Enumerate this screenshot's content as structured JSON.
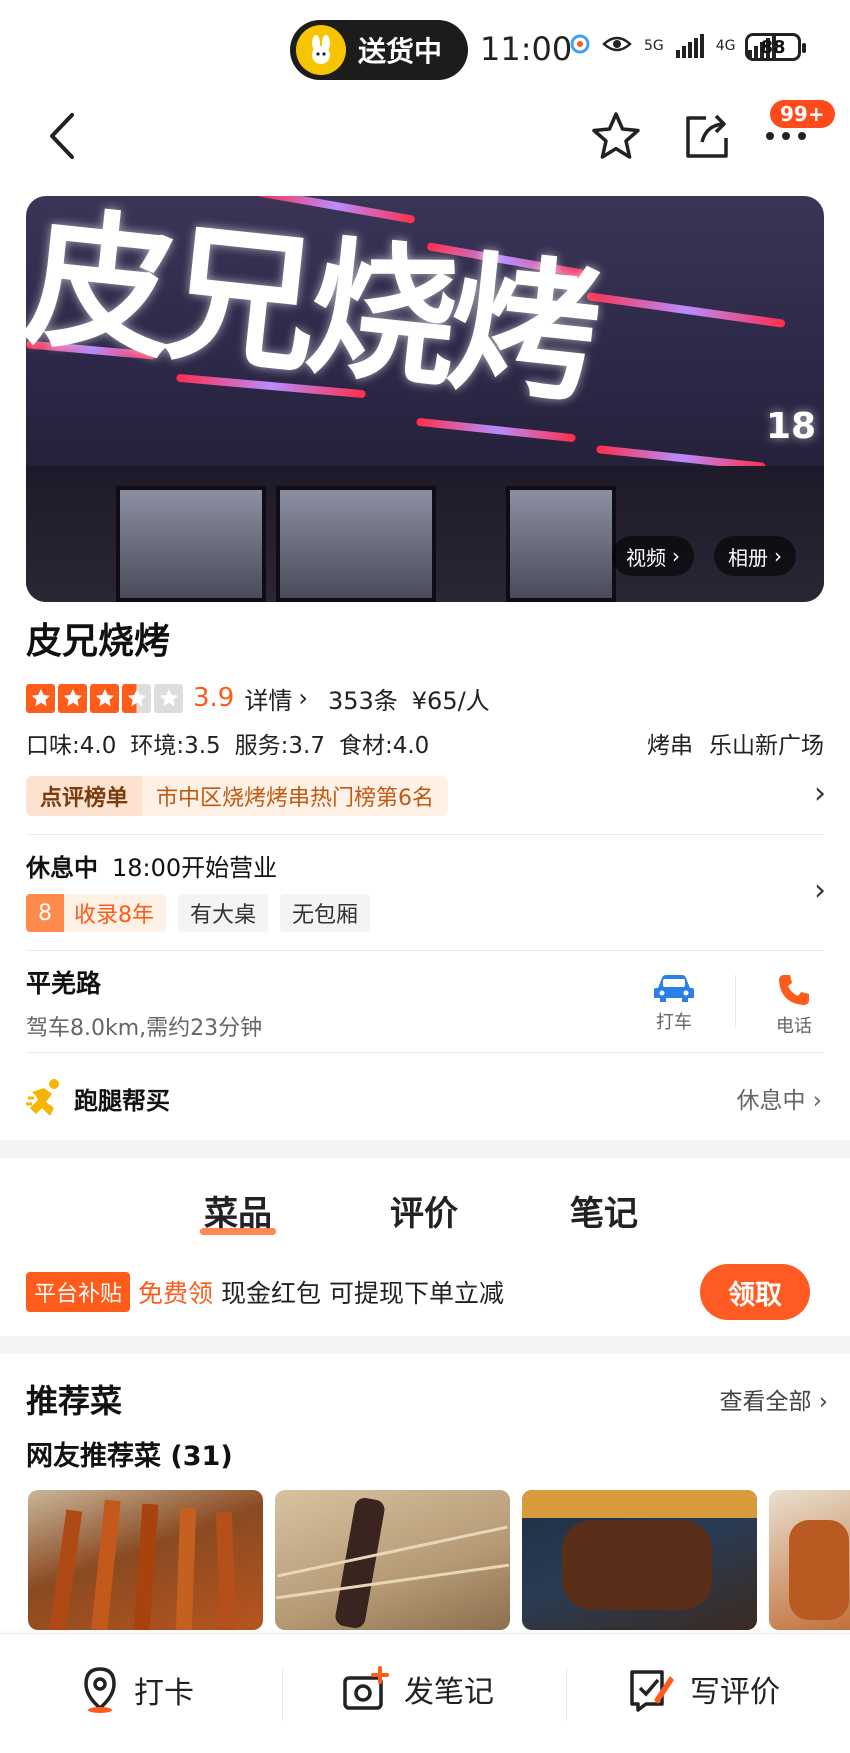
{
  "status_bar": {
    "delivery_label": "送货中",
    "time": "11:00",
    "net1": "5G",
    "net2": "4G",
    "battery": "88"
  },
  "nav": {
    "more_badge": "99+"
  },
  "hero": {
    "sign_text": "皮兄烧烤",
    "sign_phone": "18",
    "video_label": "视频",
    "album_label": "相册"
  },
  "shop": {
    "name": "皮兄烧烤",
    "rating": 3.5,
    "score": "3.9",
    "details_label": "详情",
    "review_count": "353条",
    "avg_price": "¥65/人",
    "sub_scores": [
      "口味:4.0",
      "环境:3.5",
      "服务:3.7",
      "食材:4.0"
    ],
    "category": "烤串",
    "area": "乐山新广场",
    "rank_badge": "点评榜单",
    "rank_text": "市中区烧烤烤串热门榜第6名"
  },
  "hours": {
    "status": "休息中",
    "open_time": "18:00开始营业",
    "years_num": "8",
    "years_label": "收录8年",
    "feature1": "有大桌",
    "feature2": "无包厢"
  },
  "address": {
    "road": "平羌路",
    "drive": "驾车8.0km,需约23分钟",
    "taxi_label": "打车",
    "phone_label": "电话"
  },
  "errand": {
    "label": "跑腿帮买",
    "status": "休息中"
  },
  "tabs": [
    "菜品",
    "评价",
    "笔记"
  ],
  "promo": {
    "tag": "平台补贴",
    "free": "免费领",
    "desc": "现金红包 可提现下单立减",
    "button": "领取"
  },
  "recommend": {
    "title": "推荐菜",
    "view_all": "查看全部",
    "subtitle": "网友推荐菜 (31)"
  },
  "bottom_bar": {
    "checkin": "打卡",
    "post_note": "发笔记",
    "write_review": "写评价"
  },
  "colors": {
    "accent": "#ff5b1a",
    "rank_text": "#c05a12"
  }
}
